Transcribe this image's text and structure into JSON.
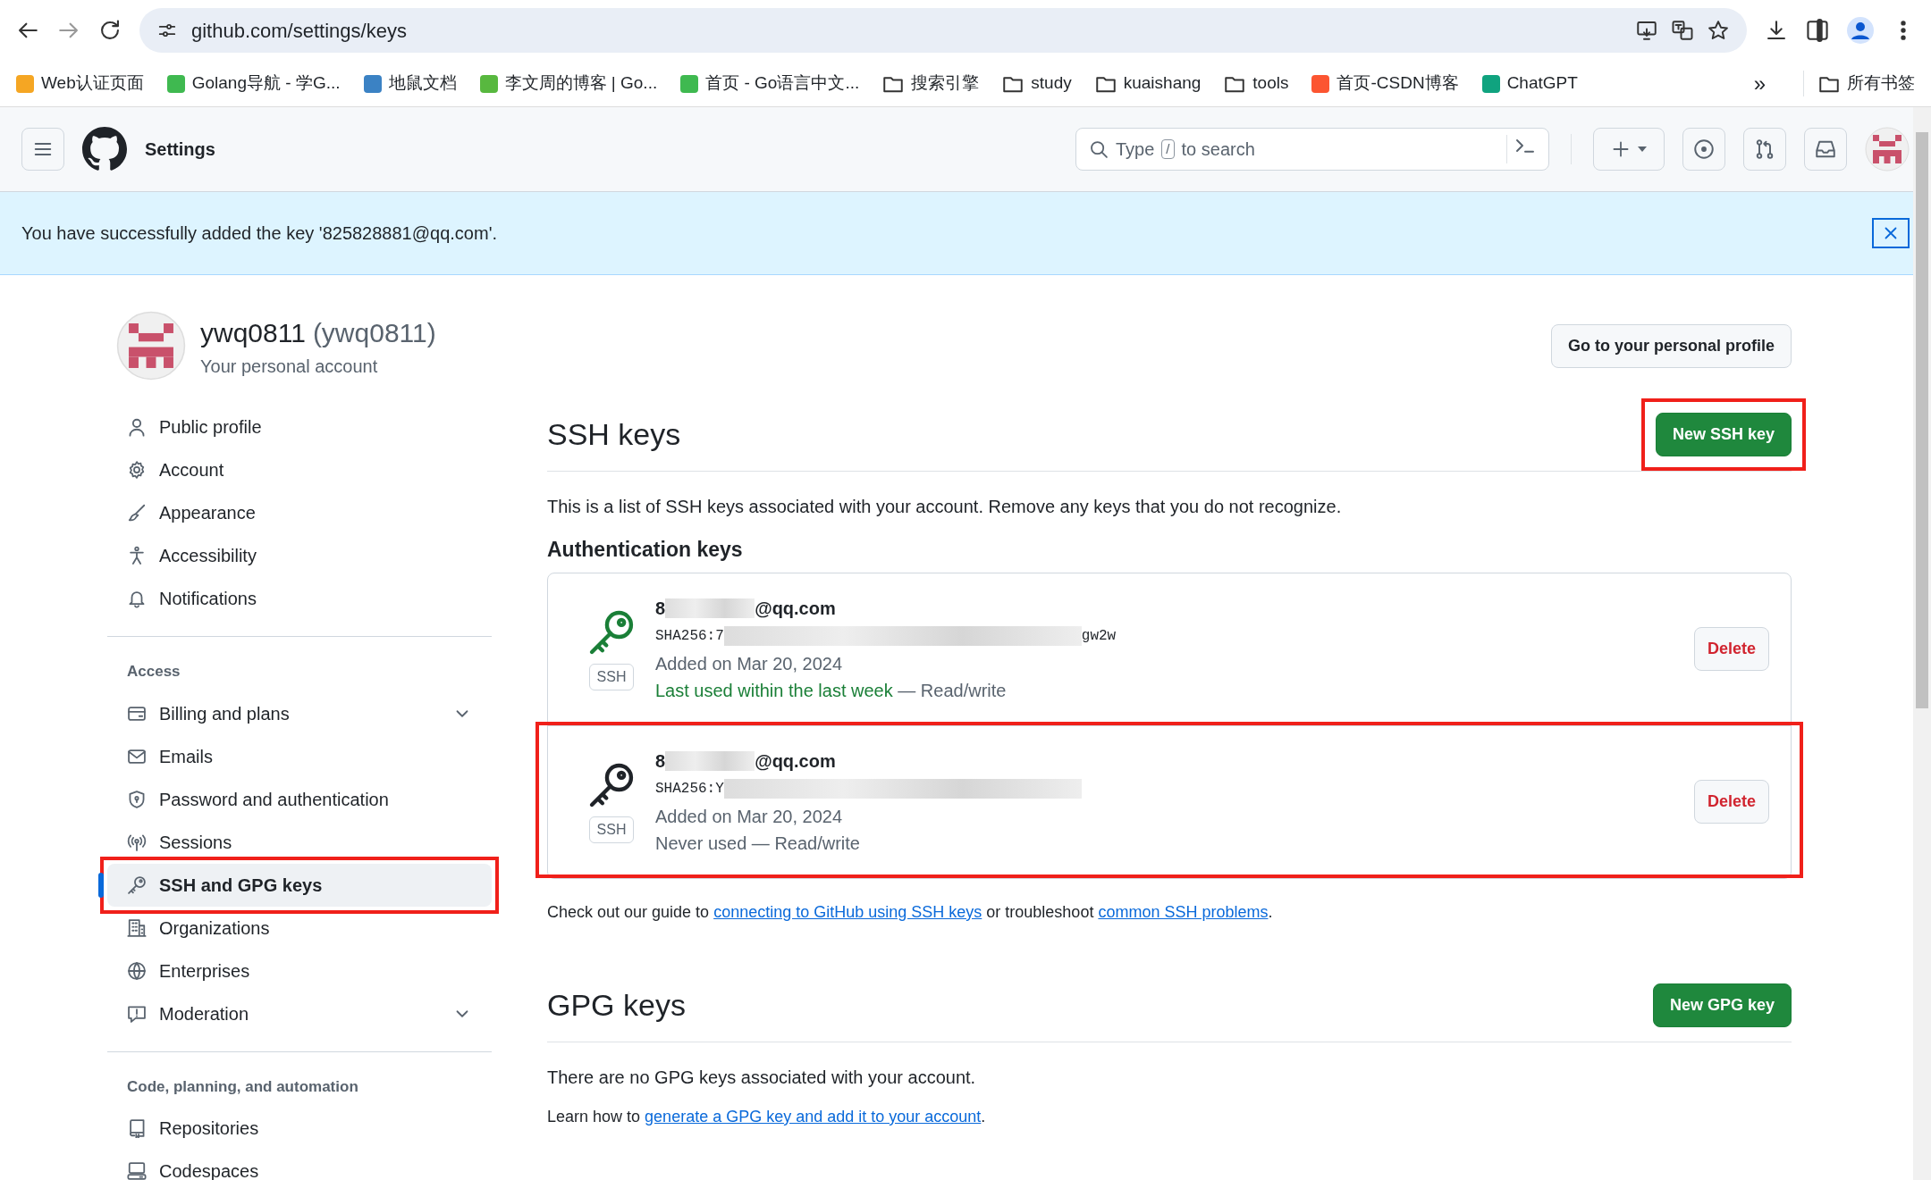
{
  "browser": {
    "url": "github.com/settings/keys",
    "bookmarks": [
      {
        "label": "Web认证页面",
        "kind": "site",
        "color": "#f5a623"
      },
      {
        "label": "Golang导航 - 学G...",
        "kind": "site",
        "color": "#3fb950"
      },
      {
        "label": "地鼠文档",
        "kind": "site",
        "color": "#3b82c4"
      },
      {
        "label": "李文周的博客 | Go...",
        "kind": "site",
        "color": "#58b83f"
      },
      {
        "label": "首页 - Go语言中文...",
        "kind": "site",
        "color": "#3fb950"
      },
      {
        "label": "搜索引擎",
        "kind": "folder"
      },
      {
        "label": "study",
        "kind": "folder"
      },
      {
        "label": "kuaishang",
        "kind": "folder"
      },
      {
        "label": "tools",
        "kind": "folder"
      },
      {
        "label": "首页-CSDN博客",
        "kind": "site",
        "color": "#fc5531"
      },
      {
        "label": "ChatGPT",
        "kind": "site",
        "color": "#10a37f"
      }
    ],
    "more": "»",
    "all_bookmarks": "所有书签"
  },
  "header": {
    "title": "Settings",
    "search": {
      "prefix": "Type",
      "key": "/",
      "suffix": "to search"
    }
  },
  "flash": {
    "message": "You have successfully added the key '825828881@qq.com'."
  },
  "profile": {
    "name": "ywq0811",
    "login": "(ywq0811)",
    "subtitle": "Your personal account",
    "button": "Go to your personal profile"
  },
  "sidebar": [
    {
      "items": [
        {
          "label": "Public profile",
          "selected": false,
          "expandable": false,
          "highlighted": false
        },
        {
          "label": "Account",
          "selected": false,
          "expandable": false,
          "highlighted": false
        },
        {
          "label": "Appearance",
          "selected": false,
          "expandable": false,
          "highlighted": false
        },
        {
          "label": "Accessibility",
          "selected": false,
          "expandable": false,
          "highlighted": false
        },
        {
          "label": "Notifications",
          "selected": false,
          "expandable": false,
          "highlighted": false
        }
      ]
    },
    {
      "heading": "Access",
      "items": [
        {
          "label": "Billing and plans",
          "selected": false,
          "expandable": true,
          "highlighted": false
        },
        {
          "label": "Emails",
          "selected": false,
          "expandable": false,
          "highlighted": false
        },
        {
          "label": "Password and authentication",
          "selected": false,
          "expandable": false,
          "highlighted": false
        },
        {
          "label": "Sessions",
          "selected": false,
          "expandable": false,
          "highlighted": false
        },
        {
          "label": "SSH and GPG keys",
          "selected": true,
          "expandable": false,
          "highlighted": true
        },
        {
          "label": "Organizations",
          "selected": false,
          "expandable": false,
          "highlighted": false
        },
        {
          "label": "Enterprises",
          "selected": false,
          "expandable": false,
          "highlighted": false
        },
        {
          "label": "Moderation",
          "selected": false,
          "expandable": true,
          "highlighted": false
        }
      ]
    },
    {
      "heading": "Code, planning, and automation",
      "items": [
        {
          "label": "Repositories",
          "selected": false,
          "expandable": false,
          "highlighted": false
        },
        {
          "label": "Codespaces",
          "selected": false,
          "expandable": false,
          "highlighted": false
        }
      ]
    }
  ],
  "ssh": {
    "title": "SSH keys",
    "button": {
      "label": "New SSH key",
      "highlighted": true
    },
    "intro": "This is a list of SSH keys associated with your account. Remove any keys that you do not recognize.",
    "subheading": "Authentication keys",
    "keys": [
      {
        "title_start": "8",
        "title_end": "@qq.com",
        "fingerprint_start": "SHA256:7",
        "fingerprint_end": "gw2w",
        "badge": "SSH",
        "added": "Added on Mar 20, 2024",
        "usage": "Last used within the last week",
        "recent": true,
        "access": "— Read/write",
        "delete": "Delete",
        "highlighted": false
      },
      {
        "title_start": "8",
        "title_end": "@qq.com",
        "fingerprint_start": "SHA256:Y",
        "badge": "SSH",
        "added": "Added on Mar 20, 2024",
        "usage": "Never used",
        "recent": false,
        "access": "— Read/write",
        "delete": "Delete",
        "highlighted": true
      }
    ],
    "guide": [
      {
        "text": "Check out our guide to",
        "link": false
      },
      {
        "text": "connecting to GitHub using SSH keys",
        "link": true
      },
      {
        "text": "or troubleshoot",
        "link": false
      },
      {
        "text": "common SSH problems",
        "link": true
      },
      {
        "text": ".",
        "link": false
      }
    ]
  },
  "gpg": {
    "title": "GPG keys",
    "button": {
      "label": "New GPG key",
      "highlighted": false
    },
    "empty": "There are no GPG keys associated with your account.",
    "learn": [
      {
        "text": "Learn how to",
        "link": false
      },
      {
        "text": "generate a GPG key and add it to your account",
        "link": true
      },
      {
        "text": ".",
        "link": false
      }
    ]
  }
}
